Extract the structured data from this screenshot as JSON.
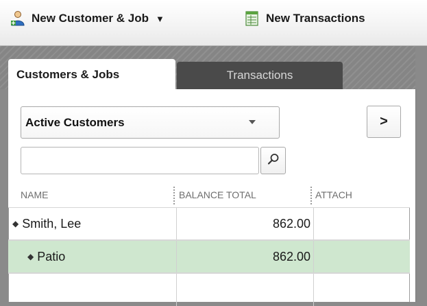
{
  "toolbar": {
    "new_customer_job": "New Customer & Job",
    "new_transactions": "New Transactions",
    "dropdown_arrow": "▼"
  },
  "tabs": [
    {
      "label": "Customers & Jobs",
      "active": true
    },
    {
      "label": "Transactions",
      "active": false
    }
  ],
  "filter": {
    "selected": "Active Customers",
    "expand_glyph": ">"
  },
  "search": {
    "value": "",
    "placeholder": ""
  },
  "columns": {
    "name": "NAME",
    "balance": "BALANCE TOTAL",
    "attach": "ATTACH"
  },
  "rows": [
    {
      "name": "Smith, Lee",
      "balance": "862.00",
      "attach": ""
    },
    {
      "name": "Patio",
      "balance": "862.00",
      "attach": ""
    },
    {
      "name": "",
      "balance": "",
      "attach": ""
    }
  ],
  "icons": {
    "new_customer": "user-add-icon",
    "new_transaction": "spreadsheet-icon",
    "search": "magnifier-icon"
  },
  "colors": {
    "selected_row": "#cfe7cf",
    "inactive_tab": "#4a4a4a",
    "background": "#8a8a8a"
  }
}
